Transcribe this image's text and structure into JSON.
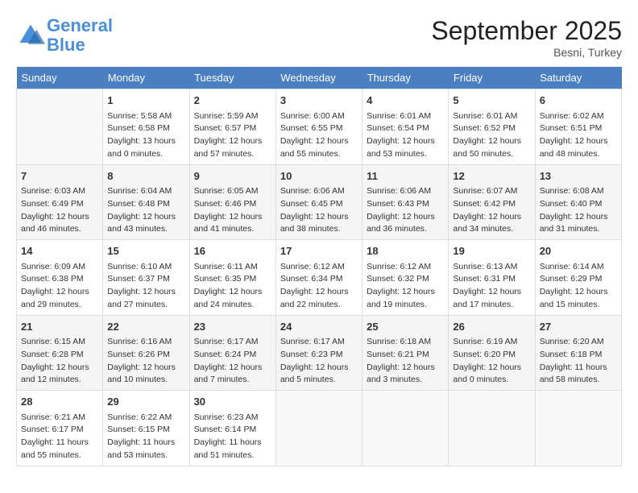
{
  "header": {
    "title": "September 2025",
    "location": "Besni, Turkey"
  },
  "logo": {
    "line1": "General",
    "line2": "Blue"
  },
  "days_of_week": [
    "Sunday",
    "Monday",
    "Tuesday",
    "Wednesday",
    "Thursday",
    "Friday",
    "Saturday"
  ],
  "weeks": [
    [
      {
        "day": "",
        "content": ""
      },
      {
        "day": "1",
        "content": "Sunrise: 5:58 AM\nSunset: 6:58 PM\nDaylight: 13 hours\nand 0 minutes."
      },
      {
        "day": "2",
        "content": "Sunrise: 5:59 AM\nSunset: 6:57 PM\nDaylight: 12 hours\nand 57 minutes."
      },
      {
        "day": "3",
        "content": "Sunrise: 6:00 AM\nSunset: 6:55 PM\nDaylight: 12 hours\nand 55 minutes."
      },
      {
        "day": "4",
        "content": "Sunrise: 6:01 AM\nSunset: 6:54 PM\nDaylight: 12 hours\nand 53 minutes."
      },
      {
        "day": "5",
        "content": "Sunrise: 6:01 AM\nSunset: 6:52 PM\nDaylight: 12 hours\nand 50 minutes."
      },
      {
        "day": "6",
        "content": "Sunrise: 6:02 AM\nSunset: 6:51 PM\nDaylight: 12 hours\nand 48 minutes."
      }
    ],
    [
      {
        "day": "7",
        "content": "Sunrise: 6:03 AM\nSunset: 6:49 PM\nDaylight: 12 hours\nand 46 minutes."
      },
      {
        "day": "8",
        "content": "Sunrise: 6:04 AM\nSunset: 6:48 PM\nDaylight: 12 hours\nand 43 minutes."
      },
      {
        "day": "9",
        "content": "Sunrise: 6:05 AM\nSunset: 6:46 PM\nDaylight: 12 hours\nand 41 minutes."
      },
      {
        "day": "10",
        "content": "Sunrise: 6:06 AM\nSunset: 6:45 PM\nDaylight: 12 hours\nand 38 minutes."
      },
      {
        "day": "11",
        "content": "Sunrise: 6:06 AM\nSunset: 6:43 PM\nDaylight: 12 hours\nand 36 minutes."
      },
      {
        "day": "12",
        "content": "Sunrise: 6:07 AM\nSunset: 6:42 PM\nDaylight: 12 hours\nand 34 minutes."
      },
      {
        "day": "13",
        "content": "Sunrise: 6:08 AM\nSunset: 6:40 PM\nDaylight: 12 hours\nand 31 minutes."
      }
    ],
    [
      {
        "day": "14",
        "content": "Sunrise: 6:09 AM\nSunset: 6:38 PM\nDaylight: 12 hours\nand 29 minutes."
      },
      {
        "day": "15",
        "content": "Sunrise: 6:10 AM\nSunset: 6:37 PM\nDaylight: 12 hours\nand 27 minutes."
      },
      {
        "day": "16",
        "content": "Sunrise: 6:11 AM\nSunset: 6:35 PM\nDaylight: 12 hours\nand 24 minutes."
      },
      {
        "day": "17",
        "content": "Sunrise: 6:12 AM\nSunset: 6:34 PM\nDaylight: 12 hours\nand 22 minutes."
      },
      {
        "day": "18",
        "content": "Sunrise: 6:12 AM\nSunset: 6:32 PM\nDaylight: 12 hours\nand 19 minutes."
      },
      {
        "day": "19",
        "content": "Sunrise: 6:13 AM\nSunset: 6:31 PM\nDaylight: 12 hours\nand 17 minutes."
      },
      {
        "day": "20",
        "content": "Sunrise: 6:14 AM\nSunset: 6:29 PM\nDaylight: 12 hours\nand 15 minutes."
      }
    ],
    [
      {
        "day": "21",
        "content": "Sunrise: 6:15 AM\nSunset: 6:28 PM\nDaylight: 12 hours\nand 12 minutes."
      },
      {
        "day": "22",
        "content": "Sunrise: 6:16 AM\nSunset: 6:26 PM\nDaylight: 12 hours\nand 10 minutes."
      },
      {
        "day": "23",
        "content": "Sunrise: 6:17 AM\nSunset: 6:24 PM\nDaylight: 12 hours\nand 7 minutes."
      },
      {
        "day": "24",
        "content": "Sunrise: 6:17 AM\nSunset: 6:23 PM\nDaylight: 12 hours\nand 5 minutes."
      },
      {
        "day": "25",
        "content": "Sunrise: 6:18 AM\nSunset: 6:21 PM\nDaylight: 12 hours\nand 3 minutes."
      },
      {
        "day": "26",
        "content": "Sunrise: 6:19 AM\nSunset: 6:20 PM\nDaylight: 12 hours\nand 0 minutes."
      },
      {
        "day": "27",
        "content": "Sunrise: 6:20 AM\nSunset: 6:18 PM\nDaylight: 11 hours\nand 58 minutes."
      }
    ],
    [
      {
        "day": "28",
        "content": "Sunrise: 6:21 AM\nSunset: 6:17 PM\nDaylight: 11 hours\nand 55 minutes."
      },
      {
        "day": "29",
        "content": "Sunrise: 6:22 AM\nSunset: 6:15 PM\nDaylight: 11 hours\nand 53 minutes."
      },
      {
        "day": "30",
        "content": "Sunrise: 6:23 AM\nSunset: 6:14 PM\nDaylight: 11 hours\nand 51 minutes."
      },
      {
        "day": "",
        "content": ""
      },
      {
        "day": "",
        "content": ""
      },
      {
        "day": "",
        "content": ""
      },
      {
        "day": "",
        "content": ""
      }
    ]
  ]
}
